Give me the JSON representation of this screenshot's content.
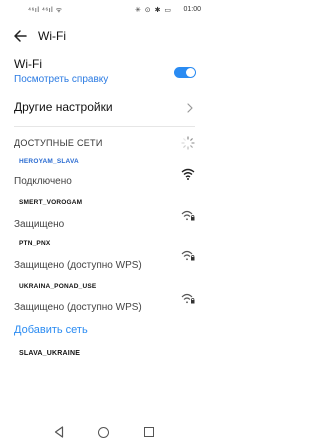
{
  "status_bar": {
    "signal_text": "⁴⁶ıl ⁴⁶ıl ᯤ",
    "icons_text": "✳ ⊙ ✱ ▭",
    "time": "01:00"
  },
  "header": {
    "title": "Wi-Fi",
    "back_icon": "arrow-left-icon"
  },
  "wifi": {
    "label": "Wi-Fi",
    "help_link": "Посмотреть справку",
    "toggle_on": true,
    "toggle_color": "#2a8bf2"
  },
  "other_settings": {
    "label": "Другие настройки"
  },
  "available": {
    "section_title": "ДОСТУПНЫЕ СЕТИ",
    "networks": [
      {
        "ssid": "HEROYAM_SLAVA",
        "status": "Подключено",
        "connected": true,
        "secured": false
      },
      {
        "ssid": "SMERT_VOROGAM",
        "status": "Защищено",
        "connected": false,
        "secured": true
      },
      {
        "ssid": "PTN_PNX",
        "status": "Защищено (доступно WPS)",
        "connected": false,
        "secured": true
      },
      {
        "ssid": "UKRAINA_PONAD_USE",
        "status": "Защищено (доступно WPS)",
        "connected": false,
        "secured": true
      }
    ]
  },
  "add_network": {
    "label": "Добавить сеть"
  },
  "saved": {
    "ssid": "SLAVA_UKRAINE"
  },
  "colors": {
    "accent": "#2a8bf2",
    "connected_ssid": "#2a6bd1"
  }
}
